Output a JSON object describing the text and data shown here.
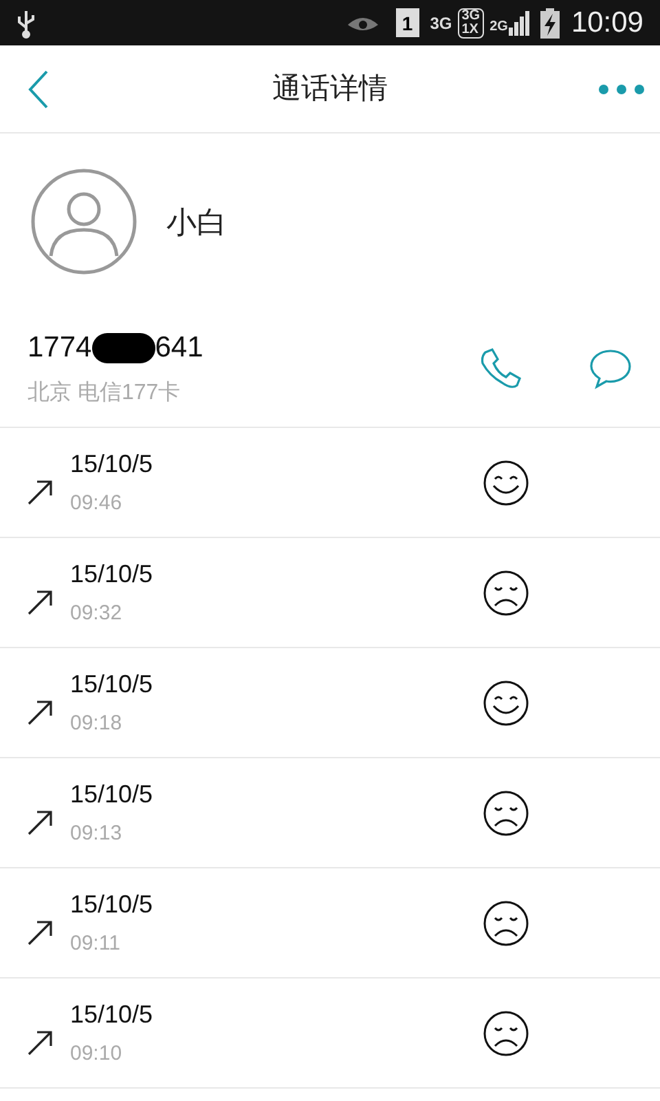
{
  "status_bar": {
    "sim": "1",
    "net_a": "3G",
    "net_b_top": "3G",
    "net_b_bottom": "1X",
    "net_c": "2G",
    "time": "10:09"
  },
  "header": {
    "title": "通话详情"
  },
  "contact": {
    "name": "小白"
  },
  "number": {
    "prefix": "1774",
    "suffix": "641",
    "location": "北京 电信177卡"
  },
  "calls": [
    {
      "date": "15/10/5",
      "time": "09:46",
      "kind": "happy"
    },
    {
      "date": "15/10/5",
      "time": "09:32",
      "kind": "sad"
    },
    {
      "date": "15/10/5",
      "time": "09:18",
      "kind": "happy"
    },
    {
      "date": "15/10/5",
      "time": "09:13",
      "kind": "sad"
    },
    {
      "date": "15/10/5",
      "time": "09:11",
      "kind": "sad"
    },
    {
      "date": "15/10/5",
      "time": "09:10",
      "kind": "sad"
    }
  ]
}
